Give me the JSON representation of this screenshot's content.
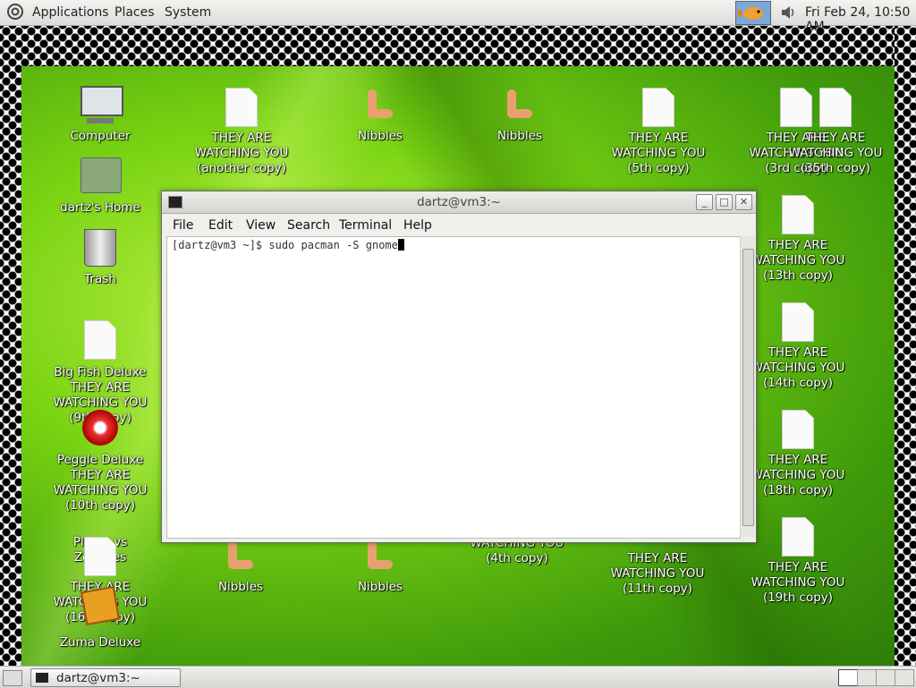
{
  "top_panel": {
    "menus": [
      "Applications",
      "Places",
      "System"
    ],
    "clock": "Fri Feb 24, 10:50 AM"
  },
  "desktop": {
    "icons": [
      {
        "label": "Computer",
        "icon": "computer-icon"
      },
      {
        "label": "dartz's Home",
        "icon": "home-folder-icon"
      },
      {
        "label": "Trash",
        "icon": "trash-icon"
      },
      {
        "label": "Big Fish Deluxe",
        "icon": "game-icon"
      },
      {
        "label": "THEY ARE WATCHING YOU (9th copy)",
        "icon": "document-icon"
      },
      {
        "label": "Peggle Deluxe",
        "icon": "game-icon"
      },
      {
        "label": "THEY ARE WATCHING YOU (10th copy)",
        "icon": "document-icon"
      },
      {
        "label": "Plants vs Zombies",
        "icon": "game-icon"
      },
      {
        "label": "THEY ARE WATCHING YOU (16th copy)",
        "icon": "document-icon"
      },
      {
        "label": "Zuma Deluxe",
        "icon": "game-icon"
      },
      {
        "label": "THEY ARE WATCHING YOU (another copy)",
        "icon": "document-icon"
      },
      {
        "label": "Nibbles",
        "icon": "nibbles-worm-icon"
      },
      {
        "label": "Nibbles",
        "icon": "nibbles-worm-icon"
      },
      {
        "label": "THEY ARE WATCHING YOU (5th copy)",
        "icon": "document-icon"
      },
      {
        "label": "THEY ARE WATCHING YOU (3rd copy)",
        "icon": "document-icon"
      },
      {
        "label": "THEY ARE WATCHING YOU (35th copy)",
        "icon": "document-icon"
      },
      {
        "label": "THEY ARE WATCHING YOU (13th copy)",
        "icon": "document-icon"
      },
      {
        "label": "THEY ARE WATCHING YOU (14th copy)",
        "icon": "document-icon"
      },
      {
        "label": "THEY ARE WATCHING YOU (18th copy)",
        "icon": "document-icon"
      },
      {
        "label": "THEY ARE WATCHING YOU (19th copy)",
        "icon": "document-icon"
      },
      {
        "label": "THEY ARE WATCHING YOU (11th copy)",
        "icon": "document-icon"
      },
      {
        "label": "WATCHING YOU (4th copy)",
        "icon": "document-icon"
      },
      {
        "label": "Nibbles",
        "icon": "nibbles-worm-icon"
      },
      {
        "label": "Nibbles",
        "icon": "nibbles-worm-icon"
      }
    ]
  },
  "terminal": {
    "title": "dartz@vm3:~",
    "menus": [
      "File",
      "Edit",
      "View",
      "Search",
      "Terminal",
      "Help"
    ],
    "prompt": "[dartz@vm3 ~]$ sudo pacman -S gnome"
  },
  "taskbar": {
    "window_label": "dartz@vm3:~"
  },
  "colors": {
    "wallpaper_green": "#79d312",
    "panel_bg": "#e6e6e2"
  }
}
